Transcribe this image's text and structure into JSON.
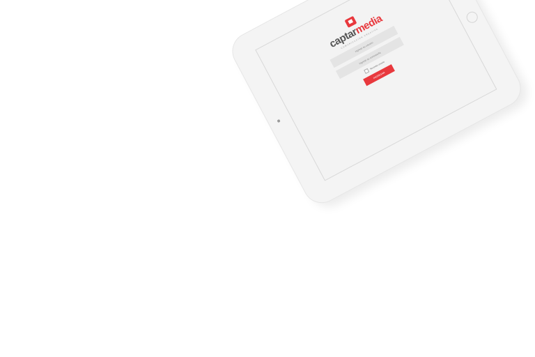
{
  "brand": {
    "name_part1": "captar",
    "name_part2": "media",
    "tagline": "COMUNICACIÓN CREATIVA",
    "accent": "#e8383d"
  },
  "login": {
    "username_placeholder": "Ingrese su usuario",
    "password_placeholder": "Ingrese su contraseña",
    "remember_label": "Recordar usuario",
    "submit_label": "INGRESAR"
  }
}
